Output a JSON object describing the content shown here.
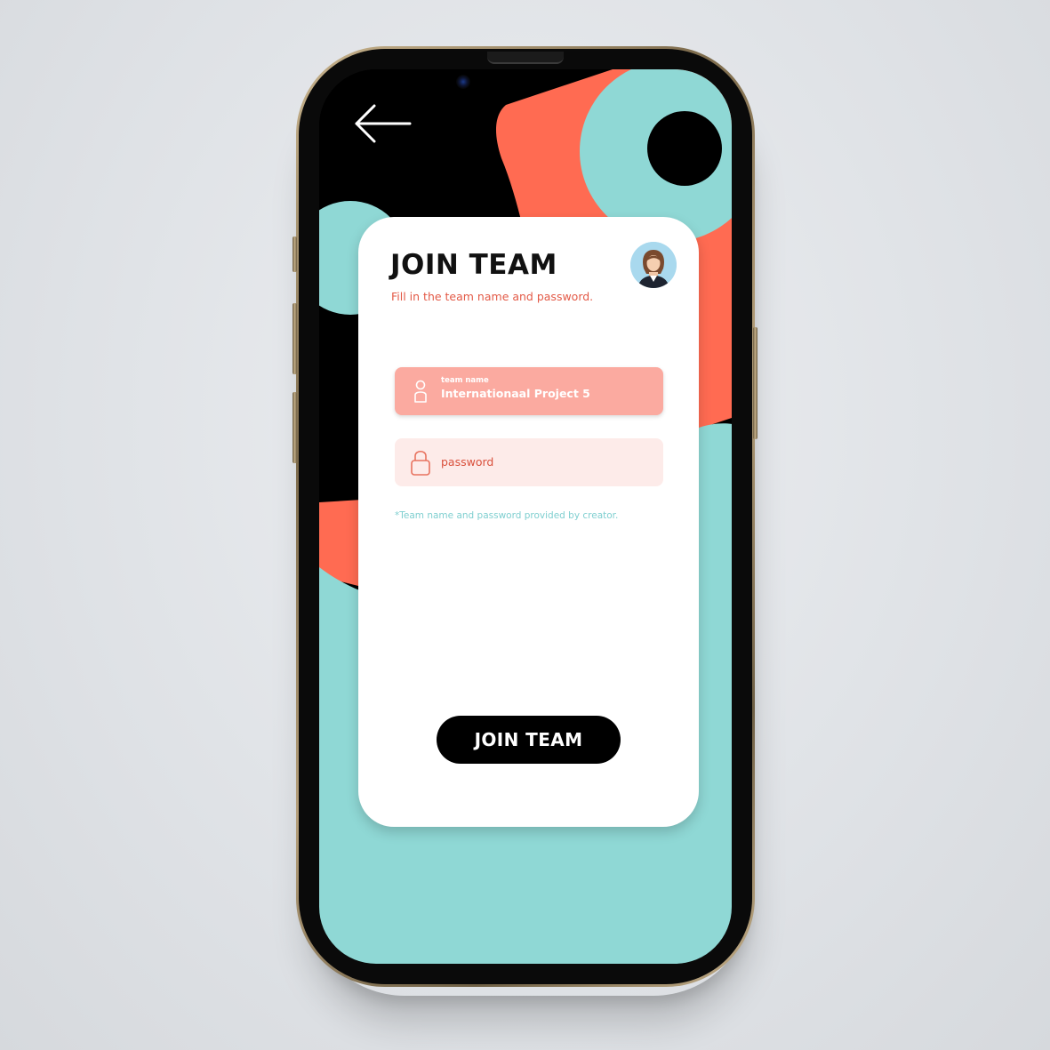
{
  "screen": {
    "back_icon": "arrow-left-icon",
    "colors": {
      "teal": "#8fd8d5",
      "coral": "#ff6b52",
      "black": "#000000",
      "card": "#ffffff",
      "field_active": "#fbaaa0",
      "field_inactive": "#fdebe9"
    }
  },
  "card": {
    "title": "JOIN TEAM",
    "subtitle": "Fill in the team name and password.",
    "avatar_icon": "woman-avatar-icon",
    "team_field": {
      "icon": "user-icon",
      "label": "team name",
      "value": "Internationaal Project 5"
    },
    "password_field": {
      "icon": "lock-icon",
      "placeholder": "password"
    },
    "hint": "*Team name and password provided by creator.",
    "button_label": "JOIN TEAM"
  }
}
